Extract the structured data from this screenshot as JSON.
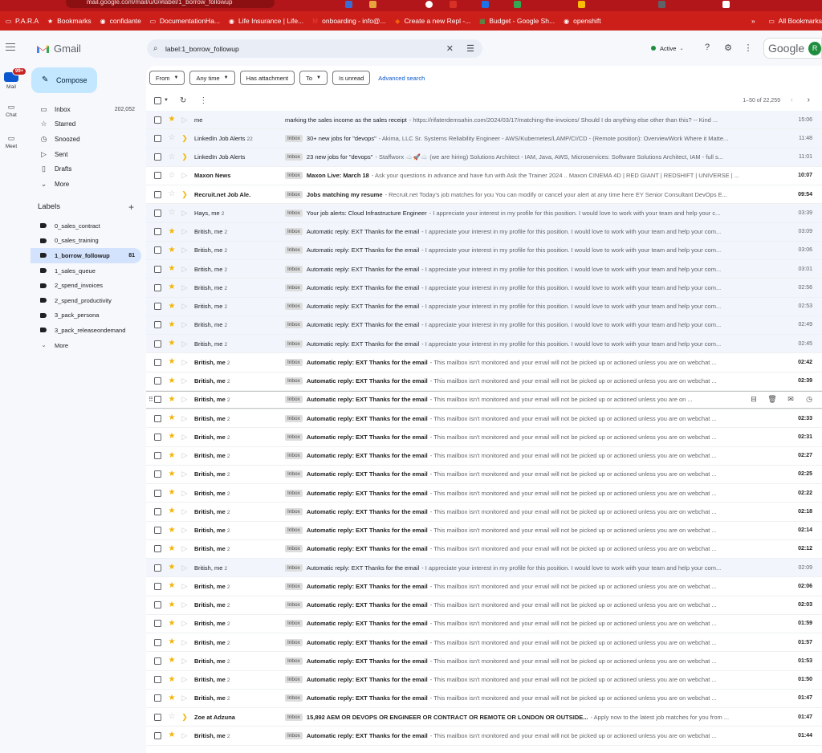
{
  "browser": {
    "url": "mail.google.com/mail/u/0/#label/1_borrow_followup",
    "bookmarks": [
      {
        "icon": "folder",
        "label": "P.A.R.A"
      },
      {
        "icon": "star",
        "label": "Bookmarks"
      },
      {
        "icon": "globe",
        "label": "confidante"
      },
      {
        "icon": "folder",
        "label": "DocumentationHa..."
      },
      {
        "icon": "globe",
        "label": "Life Insurance | Life..."
      },
      {
        "icon": "gmail",
        "label": "onboarding - info@..."
      },
      {
        "icon": "replit",
        "label": "Create a new Repl -..."
      },
      {
        "icon": "sheets",
        "label": "Budget - Google Sh..."
      },
      {
        "icon": "globe",
        "label": "openshift"
      }
    ],
    "more_label": "»",
    "all_bookmarks": "All Bookmarks"
  },
  "rail": {
    "mail_label": "Mail",
    "mail_badge": "99+",
    "chat_label": "Chat",
    "meet_label": "Meet"
  },
  "app": {
    "name": "Gmail",
    "compose_label": "Compose",
    "search_query": "label:1_borrow_followup",
    "status_label": "Active",
    "google_label": "Google",
    "avatar_letter": "R"
  },
  "nav": [
    {
      "icon": "inbox",
      "label": "Inbox",
      "count": "202,052"
    },
    {
      "icon": "star",
      "label": "Starred",
      "count": ""
    },
    {
      "icon": "clock",
      "label": "Snoozed",
      "count": ""
    },
    {
      "icon": "send",
      "label": "Sent",
      "count": ""
    },
    {
      "icon": "draft",
      "label": "Drafts",
      "count": ""
    },
    {
      "icon": "chevron-down",
      "label": "More",
      "count": ""
    }
  ],
  "labels_title": "Labels",
  "labels": [
    {
      "label": "0_sales_contract",
      "count": "",
      "active": false
    },
    {
      "label": "0_sales_training",
      "count": "",
      "active": false
    },
    {
      "label": "1_borrow_followup",
      "count": "81",
      "active": true
    },
    {
      "label": "1_sales_queue",
      "count": "",
      "active": false
    },
    {
      "label": "2_spend_invoices",
      "count": "",
      "active": false
    },
    {
      "label": "2_spend_productivity",
      "count": "",
      "active": false
    },
    {
      "label": "3_pack_persona",
      "count": "",
      "active": false
    },
    {
      "label": "3_pack_releaseondemand",
      "count": "",
      "active": false
    }
  ],
  "labels_more": "More",
  "filters": {
    "chips": [
      "From",
      "Any time",
      "Has attachment",
      "To",
      "Is unread"
    ],
    "advanced": "Advanced search"
  },
  "pager": "1–50 of 22,259",
  "inbox_tag": "Inbox",
  "emails": [
    {
      "sender": "me",
      "count": "",
      "tag": false,
      "subject": "marking the sales income as the sales receipt",
      "snippet": "- https://rifaterdemsahin.com/2024/03/17/matching-the-invoices/ Should I do anything else other than this? -- Kind ...",
      "time": "15:06",
      "starred": true,
      "important": false,
      "unread": false
    },
    {
      "sender": "LinkedIn Job Alerts",
      "count": "22",
      "tag": true,
      "subject": "30+ new jobs for \"devops\"",
      "snippet": "- Akima, LLC Sr. Systems Reliability Engineer - AWS/Kubernetes/LAMP/CI/CD - (Remote position): OverviewWork Where it Matte...",
      "time": "11:48",
      "starred": false,
      "important": true,
      "unread": false
    },
    {
      "sender": "LinkedIn Job Alerts",
      "count": "",
      "tag": true,
      "subject": "23 new jobs for \"devops\"",
      "snippet": "- Staffworx ☁️🚀☁️ (we are hiring) Solutions Architect - IAM, Java, AWS, Microservices: Software Solutions Architect, IAM - full s...",
      "time": "11:01",
      "starred": false,
      "important": true,
      "unread": false
    },
    {
      "sender": "Maxon News",
      "count": "",
      "tag": true,
      "subject": "Maxon Live: March 18",
      "snippet": "- Ask your questions in advance and have fun with Ask the Trainer 2024 .. Maxon CINEMA 4D | RED GIANT | REDSHIFT | UNIVERSE | ...",
      "time": "10:07",
      "starred": false,
      "important": false,
      "unread": true
    },
    {
      "sender": "Recruit.net Job Ale.",
      "count": "",
      "tag": true,
      "subject": "Jobs matching my resume",
      "snippet": "- Recruit.net Today's job matches for you You can modify or cancel your alert at any time here EY Senior Consultant DevOps E...",
      "time": "09:54",
      "starred": false,
      "important": true,
      "unread": true
    },
    {
      "sender": "Hays, me",
      "count": "2",
      "tag": true,
      "subject": "Your job alerts: Cloud Infrastructure Engineer",
      "snippet": "- I appreciate your interest in my profile for this position. I would love to work with your team and help your c...",
      "time": "03:39",
      "starred": false,
      "important": false,
      "unread": false
    },
    {
      "sender": "British, me",
      "count": "2",
      "tag": true,
      "subject": "Automatic reply: EXT Thanks for the email",
      "snippet": "- I appreciate your interest in my profile for this position. I would love to work with your team and help your com...",
      "time": "03:09",
      "starred": true,
      "important": false,
      "unread": false
    },
    {
      "sender": "British, me",
      "count": "2",
      "tag": true,
      "subject": "Automatic reply: EXT Thanks for the email",
      "snippet": "- I appreciate your interest in my profile for this position. I would love to work with your team and help your com...",
      "time": "03:06",
      "starred": true,
      "important": false,
      "unread": false
    },
    {
      "sender": "British, me",
      "count": "2",
      "tag": true,
      "subject": "Automatic reply: EXT Thanks for the email",
      "snippet": "- I appreciate your interest in my profile for this position. I would love to work with your team and help your com...",
      "time": "03:01",
      "starred": true,
      "important": false,
      "unread": false
    },
    {
      "sender": "British, me",
      "count": "2",
      "tag": true,
      "subject": "Automatic reply: EXT Thanks for the email",
      "snippet": "- I appreciate your interest in my profile for this position. I would love to work with your team and help your com...",
      "time": "02:56",
      "starred": true,
      "important": false,
      "unread": false
    },
    {
      "sender": "British, me",
      "count": "2",
      "tag": true,
      "subject": "Automatic reply: EXT Thanks for the email",
      "snippet": "- I appreciate your interest in my profile for this position. I would love to work with your team and help your com...",
      "time": "02:53",
      "starred": true,
      "important": false,
      "unread": false
    },
    {
      "sender": "British, me",
      "count": "2",
      "tag": true,
      "subject": "Automatic reply: EXT Thanks for the email",
      "snippet": "- I appreciate your interest in my profile for this position. I would love to work with your team and help your com...",
      "time": "02:49",
      "starred": true,
      "important": false,
      "unread": false
    },
    {
      "sender": "British, me",
      "count": "2",
      "tag": true,
      "subject": "Automatic reply: EXT Thanks for the email",
      "snippet": "- I appreciate your interest in my profile for this position. I would love to work with your team and help your com...",
      "time": "02:45",
      "starred": true,
      "important": false,
      "unread": false
    },
    {
      "sender": "British, me",
      "count": "2",
      "tag": true,
      "subject": "Automatic reply: EXT Thanks for the email",
      "snippet": "- This mailbox isn't monitored and your email will not be picked up or actioned unless you are on webchat ...",
      "time": "02:42",
      "starred": true,
      "important": false,
      "unread": true
    },
    {
      "sender": "British, me",
      "count": "2",
      "tag": true,
      "subject": "Automatic reply: EXT Thanks for the email",
      "snippet": "- This mailbox isn't monitored and your email will not be picked up or actioned unless you are on webchat ...",
      "time": "02:39",
      "starred": true,
      "important": false,
      "unread": true
    },
    {
      "sender": "British, me",
      "count": "2",
      "tag": true,
      "subject": "Automatic reply: EXT Thanks for the email",
      "snippet": "- This mailbox isn't monitored and your email will not be picked up or actioned unless you are on ...",
      "time": "",
      "starred": true,
      "important": false,
      "unread": true,
      "hover": true
    },
    {
      "sender": "British, me",
      "count": "2",
      "tag": true,
      "subject": "Automatic reply: EXT Thanks for the email",
      "snippet": "- This mailbox isn't monitored and your email will not be picked up or actioned unless you are on webchat ...",
      "time": "02:33",
      "starred": true,
      "important": false,
      "unread": true
    },
    {
      "sender": "British, me",
      "count": "2",
      "tag": true,
      "subject": "Automatic reply: EXT Thanks for the email",
      "snippet": "- This mailbox isn't monitored and your email will not be picked up or actioned unless you are on webchat ...",
      "time": "02:31",
      "starred": true,
      "important": false,
      "unread": true
    },
    {
      "sender": "British, me",
      "count": "2",
      "tag": true,
      "subject": "Automatic reply: EXT Thanks for the email",
      "snippet": "- This mailbox isn't monitored and your email will not be picked up or actioned unless you are on webchat ...",
      "time": "02:27",
      "starred": true,
      "important": false,
      "unread": true
    },
    {
      "sender": "British, me",
      "count": "2",
      "tag": true,
      "subject": "Automatic reply: EXT Thanks for the email",
      "snippet": "- This mailbox isn't monitored and your email will not be picked up or actioned unless you are on webchat ...",
      "time": "02:25",
      "starred": true,
      "important": false,
      "unread": true
    },
    {
      "sender": "British, me",
      "count": "2",
      "tag": true,
      "subject": "Automatic reply: EXT Thanks for the email",
      "snippet": "- This mailbox isn't monitored and your email will not be picked up or actioned unless you are on webchat ...",
      "time": "02:22",
      "starred": true,
      "important": false,
      "unread": true
    },
    {
      "sender": "British, me",
      "count": "2",
      "tag": true,
      "subject": "Automatic reply: EXT Thanks for the email",
      "snippet": "- This mailbox isn't monitored and your email will not be picked up or actioned unless you are on webchat ...",
      "time": "02:18",
      "starred": true,
      "important": false,
      "unread": true
    },
    {
      "sender": "British, me",
      "count": "2",
      "tag": true,
      "subject": "Automatic reply: EXT Thanks for the email",
      "snippet": "- This mailbox isn't monitored and your email will not be picked up or actioned unless you are on webchat ...",
      "time": "02:14",
      "starred": true,
      "important": false,
      "unread": true
    },
    {
      "sender": "British, me",
      "count": "2",
      "tag": true,
      "subject": "Automatic reply: EXT Thanks for the email",
      "snippet": "- This mailbox isn't monitored and your email will not be picked up or actioned unless you are on webchat ...",
      "time": "02:12",
      "starred": true,
      "important": false,
      "unread": true
    },
    {
      "sender": "British, me",
      "count": "2",
      "tag": true,
      "subject": "Automatic reply: EXT Thanks for the email",
      "snippet": "- I appreciate your interest in my profile for this position. I would love to work with your team and help your com...",
      "time": "02:09",
      "starred": true,
      "important": false,
      "unread": false
    },
    {
      "sender": "British, me",
      "count": "2",
      "tag": true,
      "subject": "Automatic reply: EXT Thanks for the email",
      "snippet": "- This mailbox isn't monitored and your email will not be picked up or actioned unless you are on webchat ...",
      "time": "02:06",
      "starred": true,
      "important": false,
      "unread": true
    },
    {
      "sender": "British, me",
      "count": "2",
      "tag": true,
      "subject": "Automatic reply: EXT Thanks for the email",
      "snippet": "- This mailbox isn't monitored and your email will not be picked up or actioned unless you are on webchat ...",
      "time": "02:03",
      "starred": true,
      "important": false,
      "unread": true
    },
    {
      "sender": "British, me",
      "count": "2",
      "tag": true,
      "subject": "Automatic reply: EXT Thanks for the email",
      "snippet": "- This mailbox isn't monitored and your email will not be picked up or actioned unless you are on webchat ...",
      "time": "01:59",
      "starred": true,
      "important": false,
      "unread": true
    },
    {
      "sender": "British, me",
      "count": "2",
      "tag": true,
      "subject": "Automatic reply: EXT Thanks for the email",
      "snippet": "- This mailbox isn't monitored and your email will not be picked up or actioned unless you are on webchat ...",
      "time": "01:57",
      "starred": true,
      "important": false,
      "unread": true
    },
    {
      "sender": "British, me",
      "count": "2",
      "tag": true,
      "subject": "Automatic reply: EXT Thanks for the email",
      "snippet": "- This mailbox isn't monitored and your email will not be picked up or actioned unless you are on webchat ...",
      "time": "01:53",
      "starred": true,
      "important": false,
      "unread": true
    },
    {
      "sender": "British, me",
      "count": "2",
      "tag": true,
      "subject": "Automatic reply: EXT Thanks for the email",
      "snippet": "- This mailbox isn't monitored and your email will not be picked up or actioned unless you are on webchat ...",
      "time": "01:50",
      "starred": true,
      "important": false,
      "unread": true
    },
    {
      "sender": "British, me",
      "count": "2",
      "tag": true,
      "subject": "Automatic reply: EXT Thanks for the email",
      "snippet": "- This mailbox isn't monitored and your email will not be picked up or actioned unless you are on webchat ...",
      "time": "01:47",
      "starred": true,
      "important": false,
      "unread": true
    },
    {
      "sender": "Zoe at Adzuna",
      "count": "",
      "tag": true,
      "subject": "15,892 AEM OR DEVOPS OR ENGINEER OR CONTRACT OR REMOTE OR LONDON OR OUTSIDE...",
      "snippet": "- Apply now to the latest job matches for you from ...",
      "time": "01:47",
      "starred": false,
      "important": true,
      "unread": true
    },
    {
      "sender": "British, me",
      "count": "2",
      "tag": true,
      "subject": "Automatic reply: EXT Thanks for the email",
      "snippet": "- This mailbox isn't monitored and your email will not be picked up or actioned unless you are on webchat ...",
      "time": "01:44",
      "starred": true,
      "important": false,
      "unread": true
    }
  ]
}
